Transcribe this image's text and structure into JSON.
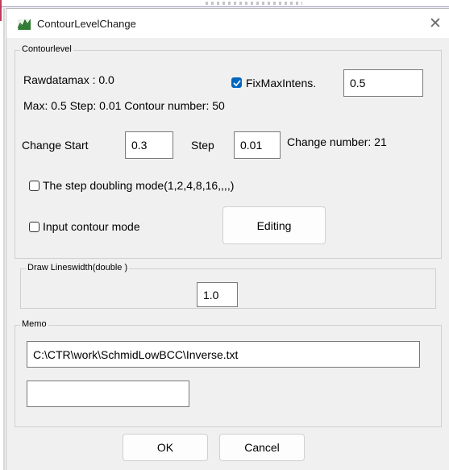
{
  "window": {
    "title": "ContourLevelChange",
    "close_symbol": "✕"
  },
  "contourlevel": {
    "legend": "Contourlevel",
    "rawdatamax_label": "Rawdatamax : 0.0",
    "fixmax_label": "FixMaxIntens.",
    "fixmax_checked": true,
    "fixmax_value": "0.5",
    "summary_label": "Max: 0.5  Step: 0.01  Contour number: 50",
    "change_start_label": "Change Start",
    "change_start_value": "0.3",
    "step_label": "Step",
    "step_value": "0.01",
    "change_number_label": "Change number: 21",
    "doubling_label": "The step doubling mode(1,2,4,8,16,,,,)",
    "doubling_checked": false,
    "input_contour_label": "Input contour mode",
    "input_contour_checked": false,
    "editing_button": "Editing"
  },
  "linewidth": {
    "legend": "Draw Lineswidth(double )",
    "value": "1.0"
  },
  "memo": {
    "legend": "Memo",
    "path_value": "C:\\CTR\\work\\SchmidLowBCC\\Inverse.txt",
    "extra_value": ""
  },
  "buttons": {
    "ok": "OK",
    "cancel": "Cancel"
  },
  "colors": {
    "checkbox_accent": "#0067c0",
    "app_icon": "#2e7d32"
  }
}
